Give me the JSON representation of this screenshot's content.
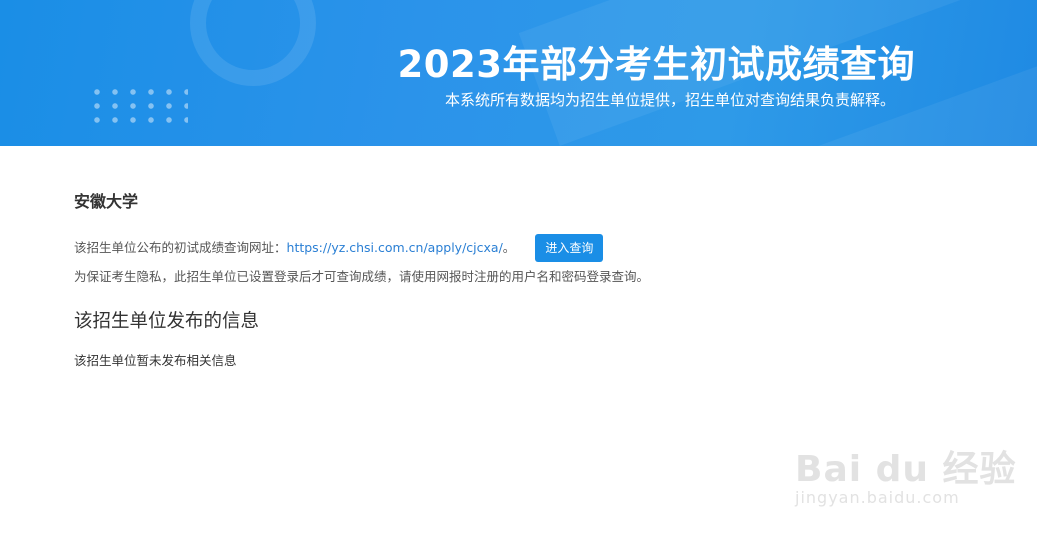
{
  "header": {
    "title": "2023年部分考生初试成绩查询",
    "subtitle": "本系统所有数据均为招生单位提供，招生单位对查询结果负责解释。"
  },
  "school": {
    "name": "安徽大学",
    "query_prefix": "该招生单位公布的初试成绩查询网址：",
    "query_url": "https://yz.chsi.com.cn/apply/cjcxa/",
    "query_suffix": "。",
    "enter_button": "进入查询",
    "privacy_note": "为保证考生隐私，此招生单位已设置登录后才可查询成绩，请使用网报时注册的用户名和密码登录查询。"
  },
  "info_section": {
    "title": "该招生单位发布的信息",
    "body": "该招生单位暂未发布相关信息"
  },
  "watermark": {
    "logo": "Bai du 经验",
    "url": "jingyan.baidu.com"
  }
}
